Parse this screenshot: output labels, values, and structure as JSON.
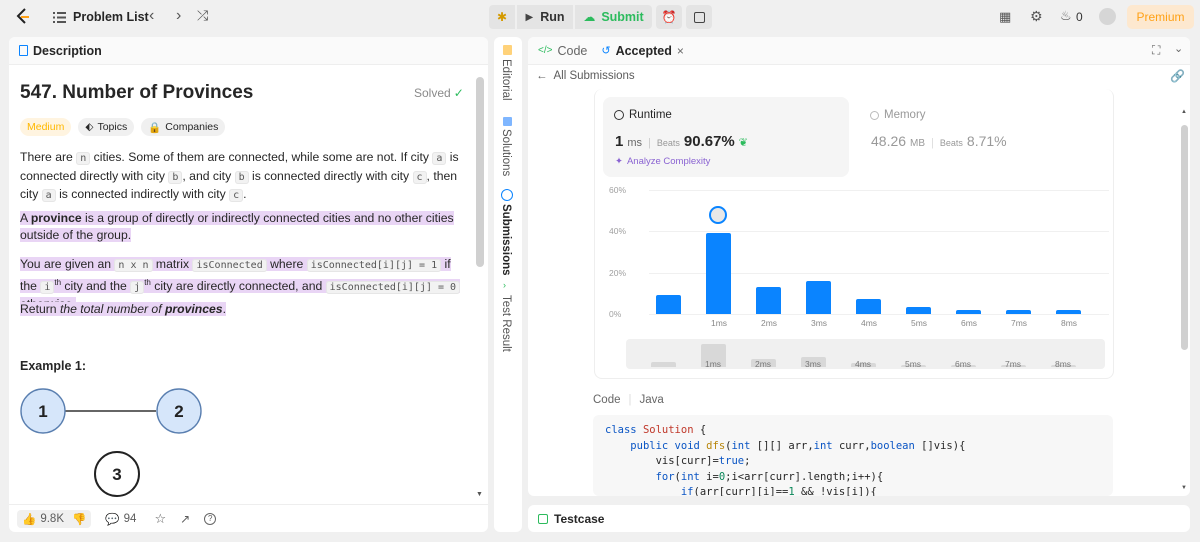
{
  "topbar": {
    "problem_list": "Problem List",
    "run": "Run",
    "submit": "Submit",
    "streak_count": "0",
    "premium": "Premium"
  },
  "left": {
    "tab_description": "Description",
    "title": "547. Number of Provinces",
    "solved": "Solved",
    "difficulty": "Medium",
    "topics": "Topics",
    "companies": "Companies",
    "p1": {
      "t1": "There are ",
      "c1": "n",
      "t2": " cities. Some of them are connected, while some are not. If city ",
      "c2": "a",
      "t3": " is connected directly with city ",
      "c3": "b",
      "t4": ", and city ",
      "c4": "b",
      "t5": " is connected directly with city ",
      "c5": "c",
      "t6": ", then city ",
      "c6": "a",
      "t7": " is connected indirectly with city ",
      "c7": "c",
      "t8": "."
    },
    "p2": {
      "t1": "A ",
      "b1": "province",
      "t2": " is a group of directly or indirectly connected cities and no other cities outside of the group."
    },
    "p3": {
      "t1": "You are given an ",
      "c1": "n x n",
      "t2": " matrix ",
      "c2": "isConnected",
      "t3": " where ",
      "c3": "isConnected[i][j] = 1",
      "t4": " if the ",
      "sup1": "th",
      "i": "i",
      "t5": " city and the ",
      "j": "j",
      "sup2": "th",
      "t6": " city are directly connected, and ",
      "c4": "isConnected[i][j] = 0",
      "t7": " otherwise."
    },
    "p4": {
      "t1": "Return ",
      "i1": "the total number of ",
      "b1": "provinces",
      "t2": "."
    },
    "example_label": "Example 1:",
    "nodes": [
      "1",
      "2",
      "3"
    ],
    "likes": "9.8K",
    "comments": "94"
  },
  "vtabs": {
    "editorial": "Editorial",
    "solutions": "Solutions",
    "submissions": "Submissions",
    "test_result": "Test Result"
  },
  "right": {
    "tab_code": "Code",
    "tab_accepted": "Accepted",
    "all_submissions": "All Submissions",
    "runtime_label": "Runtime",
    "runtime_value": "1",
    "runtime_unit": "ms",
    "beats_label": "Beats",
    "runtime_beats": "90.67%",
    "analyze": "Analyze Complexity",
    "memory_label": "Memory",
    "memory_value": "48.26",
    "memory_unit": "MB",
    "memory_beats": "8.71%",
    "code_label": "Code",
    "lang": "Java",
    "code_lines": [
      "class Solution {",
      "    public void dfs(int [][] arr,int curr,boolean []vis){",
      "        vis[curr]=true;",
      "        for(int i=0;i<arr[curr].length;i++){",
      "            if(arr[curr][i]==1 && !vis[i]){"
    ]
  },
  "bottom": {
    "testcase": "Testcase"
  },
  "chart_data": {
    "type": "bar",
    "categories": [
      "",
      "1ms",
      "2ms",
      "3ms",
      "4ms",
      "5ms",
      "6ms",
      "7ms",
      "8ms"
    ],
    "values": [
      9,
      39,
      13,
      16,
      7.5,
      3.5,
      2,
      2,
      2
    ],
    "y_ticks": [
      "60%",
      "40%",
      "20%",
      "0%"
    ],
    "ylim": [
      0,
      60
    ],
    "highlight_index": 1,
    "colors": {
      "bar": "#0a84ff"
    }
  }
}
